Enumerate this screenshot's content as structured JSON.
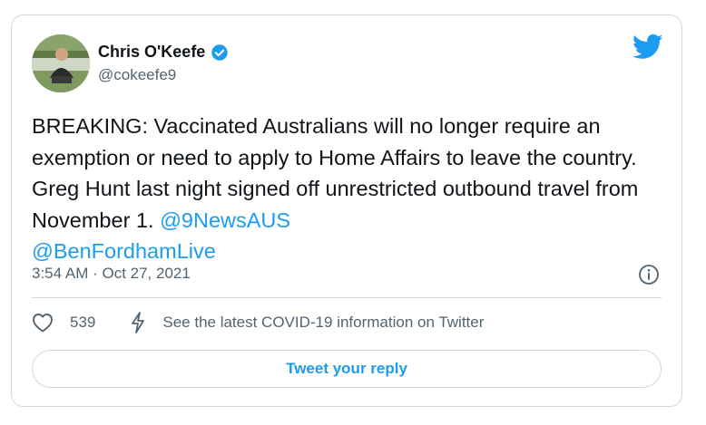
{
  "tweet": {
    "author": {
      "name": "Chris O'Keefe",
      "handle": "@cokeefe9",
      "verified": true
    },
    "text_parts": {
      "main": "BREAKING: Vaccinated Australians will no longer require an exemption or need to apply to Home Affairs to leave the country. Greg Hunt last night signed off unrestricted outbound travel from November 1. ",
      "mention1": "@9NewsAUS",
      "mention2": "@BenFordhamLive"
    },
    "timestamp": "3:54 AM · Oct 27, 2021",
    "likes": "539",
    "covid_info": "See the latest COVID-19 information on Twitter",
    "reply_button": "Tweet your reply"
  },
  "icons": {
    "brand": "twitter-bird-icon",
    "verified": "verified-badge-icon",
    "info": "info-icon",
    "like": "heart-icon",
    "covid": "lightning-icon"
  },
  "colors": {
    "accent": "#1d9bf0",
    "text": "#0f1419",
    "muted": "#536471",
    "border": "#cfd9de"
  }
}
